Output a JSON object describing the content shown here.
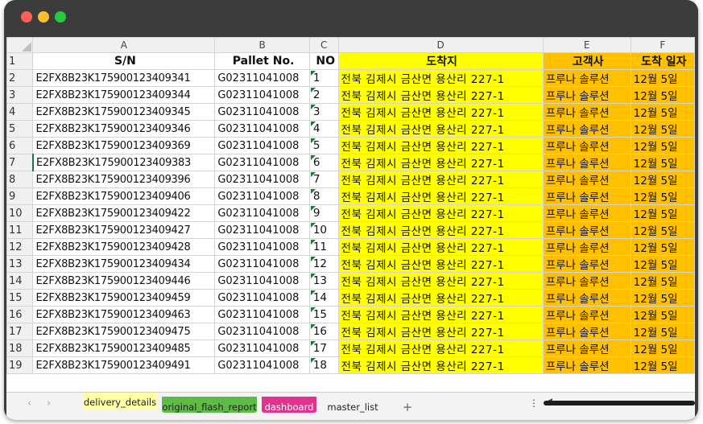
{
  "window": {
    "controls": [
      "close",
      "minimize",
      "maximize"
    ]
  },
  "columns": [
    "A",
    "B",
    "C",
    "D",
    "E",
    "F"
  ],
  "header_row": {
    "row_number": "1",
    "cells": [
      "S/N",
      "Pallet No.",
      "NO",
      "도착지",
      "고객사",
      "도착 일자"
    ]
  },
  "rows": [
    {
      "n": "2",
      "sn": "E2FX8B23K175900123409341",
      "pallet": "G02311041008",
      "no": "1",
      "dest": "전북 김제시 금산면 용산리 227-1",
      "customer": "프루나 솔루션",
      "date": "12월 5일"
    },
    {
      "n": "3",
      "sn": "E2FX8B23K175900123409344",
      "pallet": "G02311041008",
      "no": "2",
      "dest": "전북 김제시 금산면 용산리 227-1",
      "customer": "프루나 솔루션",
      "date": "12월 5일"
    },
    {
      "n": "4",
      "sn": "E2FX8B23K175900123409345",
      "pallet": "G02311041008",
      "no": "3",
      "dest": "전북 김제시 금산면 용산리 227-1",
      "customer": "프루나 솔루션",
      "date": "12월 5일"
    },
    {
      "n": "5",
      "sn": "E2FX8B23K175900123409346",
      "pallet": "G02311041008",
      "no": "4",
      "dest": "전북 김제시 금산면 용산리 227-1",
      "customer": "프루나 솔루션",
      "date": "12월 5일"
    },
    {
      "n": "6",
      "sn": "E2FX8B23K175900123409369",
      "pallet": "G02311041008",
      "no": "5",
      "dest": "전북 김제시 금산면 용산리 227-1",
      "customer": "프루나 솔루션",
      "date": "12월 5일"
    },
    {
      "n": "7",
      "sn": "E2FX8B23K175900123409383",
      "pallet": "G02311041008",
      "no": "6",
      "dest": "전북 김제시 금산면 용산리 227-1",
      "customer": "프루나 솔루션",
      "date": "12월 5일"
    },
    {
      "n": "8",
      "sn": "E2FX8B23K175900123409396",
      "pallet": "G02311041008",
      "no": "7",
      "dest": "전북 김제시 금산면 용산리 227-1",
      "customer": "프루나 솔루션",
      "date": "12월 5일"
    },
    {
      "n": "9",
      "sn": "E2FX8B23K175900123409406",
      "pallet": "G02311041008",
      "no": "8",
      "dest": "전북 김제시 금산면 용산리 227-1",
      "customer": "프루나 솔루션",
      "date": "12월 5일"
    },
    {
      "n": "10",
      "sn": "E2FX8B23K175900123409422",
      "pallet": "G02311041008",
      "no": "9",
      "dest": "전북 김제시 금산면 용산리 227-1",
      "customer": "프루나 솔루션",
      "date": "12월 5일"
    },
    {
      "n": "11",
      "sn": "E2FX8B23K175900123409427",
      "pallet": "G02311041008",
      "no": "10",
      "dest": "전북 김제시 금산면 용산리 227-1",
      "customer": "프루나 솔루션",
      "date": "12월 5일"
    },
    {
      "n": "12",
      "sn": "E2FX8B23K175900123409428",
      "pallet": "G02311041008",
      "no": "11",
      "dest": "전북 김제시 금산면 용산리 227-1",
      "customer": "프루나 솔루션",
      "date": "12월 5일"
    },
    {
      "n": "13",
      "sn": "E2FX8B23K175900123409434",
      "pallet": "G02311041008",
      "no": "12",
      "dest": "전북 김제시 금산면 용산리 227-1",
      "customer": "프루나 솔루션",
      "date": "12월 5일"
    },
    {
      "n": "14",
      "sn": "E2FX8B23K175900123409446",
      "pallet": "G02311041008",
      "no": "13",
      "dest": "전북 김제시 금산면 용산리 227-1",
      "customer": "프루나 솔루션",
      "date": "12월 5일"
    },
    {
      "n": "15",
      "sn": "E2FX8B23K175900123409459",
      "pallet": "G02311041008",
      "no": "14",
      "dest": "전북 김제시 금산면 용산리 227-1",
      "customer": "프루나 솔루션",
      "date": "12월 5일"
    },
    {
      "n": "16",
      "sn": "E2FX8B23K175900123409463",
      "pallet": "G02311041008",
      "no": "15",
      "dest": "전북 김제시 금산면 용산리 227-1",
      "customer": "프루나 솔루션",
      "date": "12월 5일"
    },
    {
      "n": "17",
      "sn": "E2FX8B23K175900123409475",
      "pallet": "G02311041008",
      "no": "16",
      "dest": "전북 김제시 금산면 용산리 227-1",
      "customer": "프루나 솔루션",
      "date": "12월 5일"
    },
    {
      "n": "18",
      "sn": "E2FX8B23K175900123409485",
      "pallet": "G02311041008",
      "no": "17",
      "dest": "전북 김제시 금산면 용산리 227-1",
      "customer": "프루나 솔루션",
      "date": "12월 5일"
    },
    {
      "n": "19",
      "sn": "E2FX8B23K175900123409491",
      "pallet": "G02311041008",
      "no": "18",
      "dest": "전북 김제시 금산면 용산리 227-1",
      "customer": "프루나 솔루션",
      "date": "12월 5일"
    }
  ],
  "active_row": "7",
  "sheet_tabs": [
    {
      "label": "delivery_details",
      "color": "#ffffa8"
    },
    {
      "label": "original_flash_report",
      "color": "#5dbb46"
    },
    {
      "label": "dashboard",
      "color": "#e0338f"
    },
    {
      "label": "master_list",
      "color": ""
    }
  ],
  "add_tab_label": "+",
  "nav": {
    "prev": "‹",
    "next": "›"
  },
  "more_label": "⋮",
  "colors": {
    "dest_fill": "#ffff00",
    "customer_fill": "#ffc000"
  }
}
